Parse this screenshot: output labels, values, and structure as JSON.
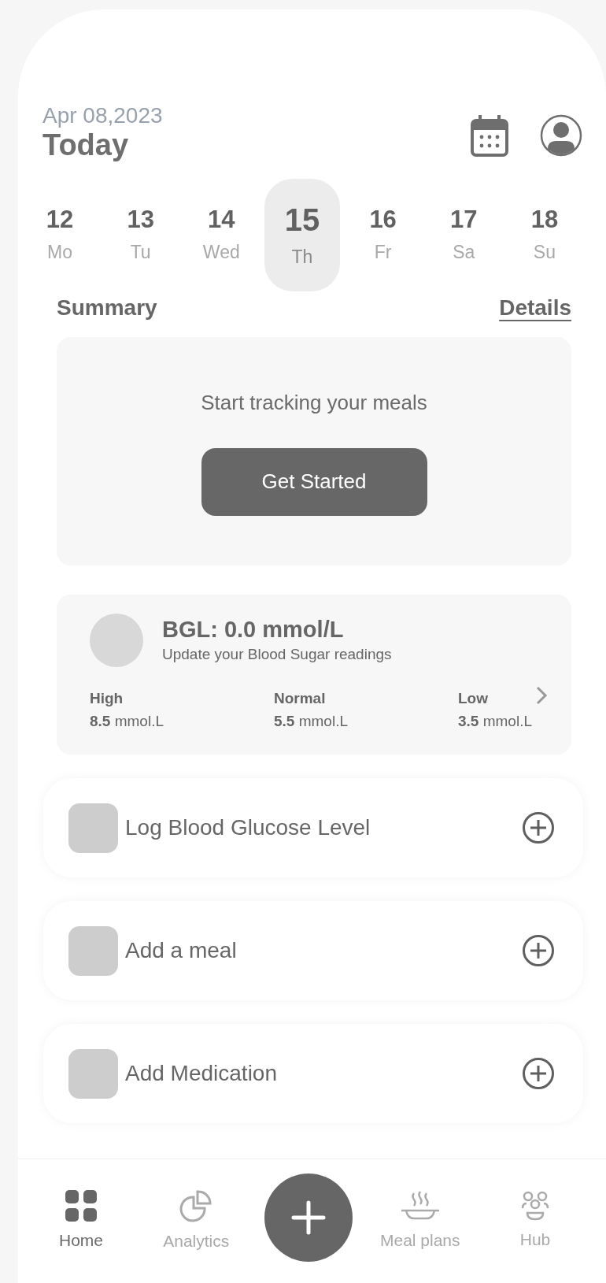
{
  "header": {
    "date": "Apr 08,2023",
    "title": "Today"
  },
  "days": [
    {
      "number": "12",
      "weekday": "Mo",
      "selected": false
    },
    {
      "number": "13",
      "weekday": "Tu",
      "selected": false
    },
    {
      "number": "14",
      "weekday": "Wed",
      "selected": false
    },
    {
      "number": "15",
      "weekday": "Th",
      "selected": true
    },
    {
      "number": "16",
      "weekday": "Fr",
      "selected": false
    },
    {
      "number": "17",
      "weekday": "Sa",
      "selected": false
    },
    {
      "number": "18",
      "weekday": "Su",
      "selected": false
    }
  ],
  "summary": {
    "title": "Summary",
    "link": "Details"
  },
  "tracking": {
    "message": "Start tracking your meals",
    "button": "Get Started"
  },
  "bgl": {
    "title": "BGL: 0.0 mmol/L",
    "subtitle": "Update your Blood Sugar readings",
    "ranges": [
      {
        "label": "High",
        "value": "**8.5** mmol.L"
      },
      {
        "label": "Normal",
        "value": "**5.5** mmol.L"
      },
      {
        "label": "Low",
        "value": "**3.5** mmol.L"
      }
    ]
  },
  "actions": [
    {
      "label": "Log Blood Glucose Level"
    },
    {
      "label": "Add a meal"
    },
    {
      "label": "Add Medication"
    }
  ],
  "nav": [
    {
      "kind": "grid",
      "label": "Home",
      "selected": true
    },
    {
      "kind": "chart",
      "label": "Analytics",
      "selected": false
    },
    {
      "kind": "add",
      "selected": false
    },
    {
      "kind": "dish",
      "label": "Meal plans",
      "selected": false
    },
    {
      "kind": "people",
      "label": "Hub",
      "selected": false
    }
  ]
}
